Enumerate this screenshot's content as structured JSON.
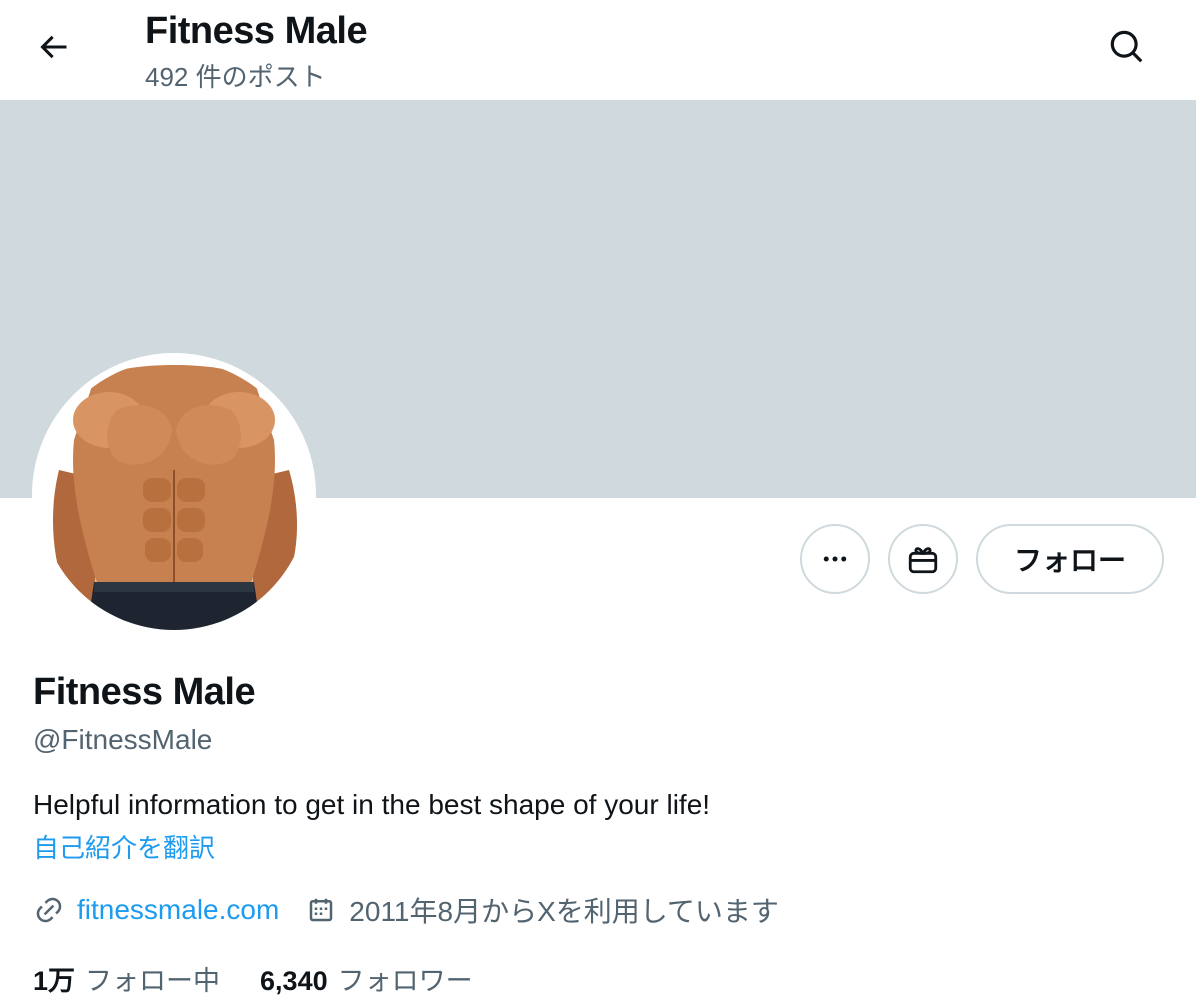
{
  "header": {
    "title": "Fitness Male",
    "post_count": "492 件のポスト",
    "back_icon": "arrow-left-icon",
    "search_icon": "search-icon"
  },
  "banner": {
    "color": "#cfd9de"
  },
  "actions": {
    "more_icon": "more-horizontal-icon",
    "gift_icon": "gift-icon",
    "follow_label": "フォロー"
  },
  "profile": {
    "display_name": "Fitness Male",
    "handle": "@FitnessMale",
    "bio": "Helpful information to get in the best shape of your life!",
    "translate_label": "自己紹介を翻訳",
    "website": "fitnessmale.com",
    "joined": "2011年8月からXを利用しています",
    "link_icon": "link-icon",
    "calendar_icon": "calendar-icon"
  },
  "stats": {
    "following_count": "1万",
    "following_label": "フォロー中",
    "followers_count": "6,340",
    "followers_label": "フォロワー"
  },
  "colors": {
    "accent": "#1d9bf0",
    "secondary_text": "#536471",
    "primary_text": "#0f1419",
    "border": "#cfd9de"
  }
}
